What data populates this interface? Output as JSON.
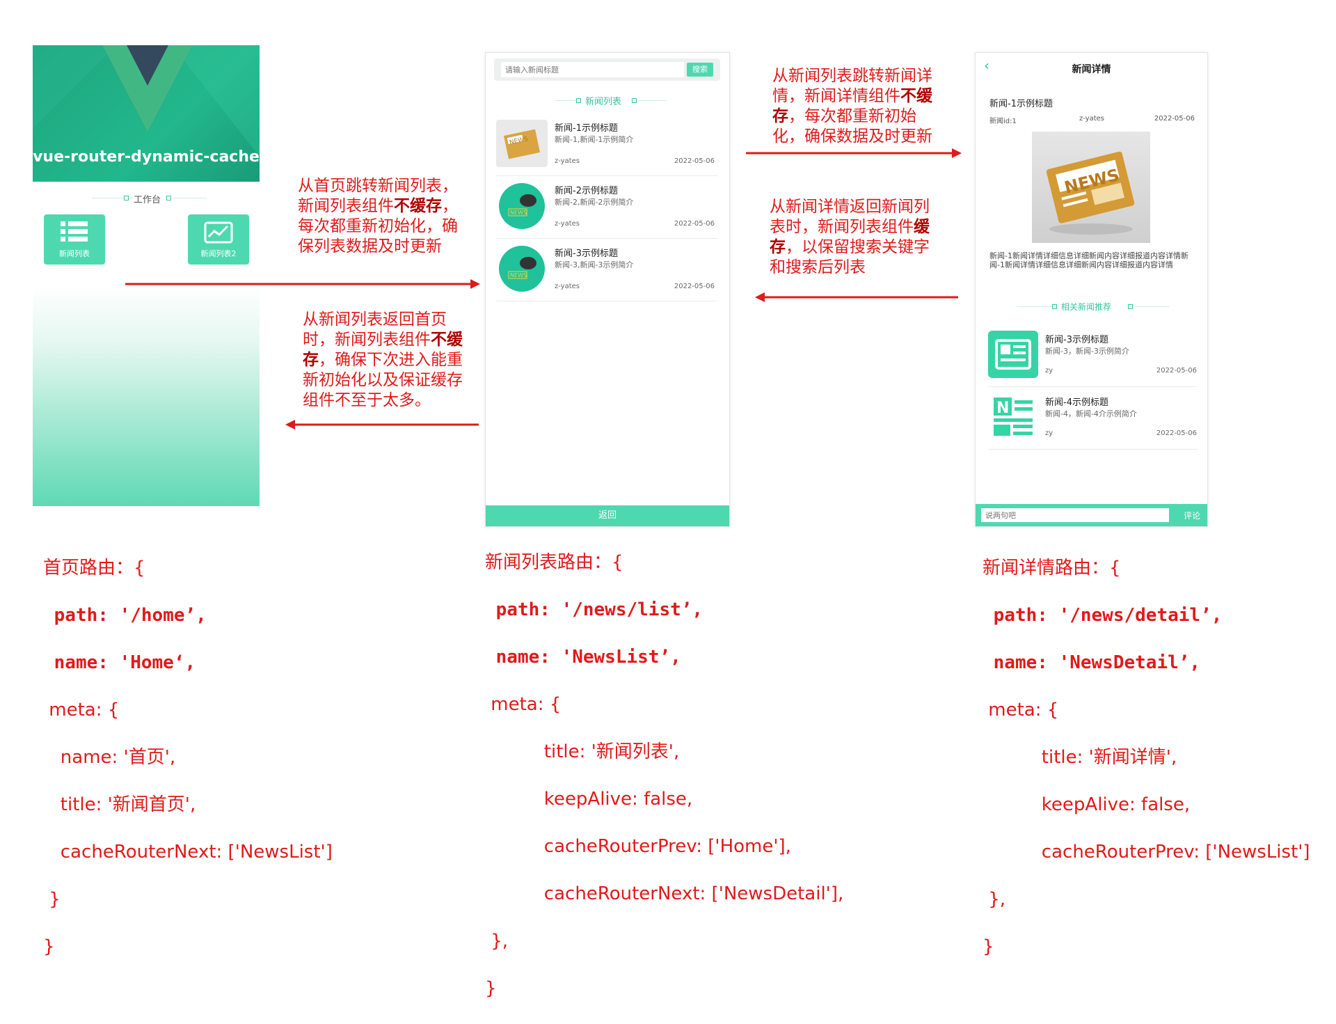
{
  "home": {
    "hero_title": "vue-router-dynamic-cache",
    "section_label": "工作台",
    "tiles": [
      {
        "label": "新闻列表",
        "icon": "list-icon"
      },
      {
        "label": "新闻列表2",
        "icon": "chart-icon"
      }
    ],
    "colors": {
      "accent": "#4ed8b0",
      "hero": "#1fa67f"
    }
  },
  "news_list": {
    "search_placeholder": "请输入新闻标题",
    "search_button": "搜索",
    "section_label": "新闻列表",
    "items": [
      {
        "title": "新闻-1示例标题",
        "desc": "新闻-1,新闻-1示例简介",
        "author": "z-yates",
        "date": "2022-05-06",
        "thumb": "newspaper-icon"
      },
      {
        "title": "新闻-2示例标题",
        "desc": "新闻-2,新闻-2示例简介",
        "author": "z-yates",
        "date": "2022-05-06",
        "thumb": "news-mic-icon"
      },
      {
        "title": "新闻-3示例标题",
        "desc": "新闻-3,新闻-3示例简介",
        "author": "z-yates",
        "date": "2022-05-06",
        "thumb": "news-mic-icon"
      }
    ],
    "back_button": "返回"
  },
  "news_detail": {
    "header_title": "新闻详情",
    "article_title": "新闻-1示例标题",
    "news_id": "新闻id:1",
    "author": "z-yates",
    "date": "2022-05-06",
    "image_label": "NEWS",
    "body": "新闻-1新闻详情详细信息详细新闻内容详细报道内容详情新闻-1新闻详情详细信息详细新闻内容详细报道内容详情",
    "related_label": "相关新闻推荐",
    "related": [
      {
        "title": "新闻-3示例标题",
        "desc": "新闻-3，新闻-3示例简介",
        "author": "zy",
        "date": "2022-05-06",
        "thumb": "article-icon"
      },
      {
        "title": "新闻-4示例标题",
        "desc": "新闻-4，新闻-4介示例简介",
        "author": "zy",
        "date": "2022-05-06",
        "thumb": "newsletter-icon"
      }
    ],
    "comment_placeholder": "说两句吧",
    "comment_button": "评论"
  },
  "notes": {
    "home_to_list": {
      "pre": "从首页跳转新闻列表，新闻列表组件",
      "bold": "不缓存",
      "post": "，每次都重新初始化，确保列表数据及时更新"
    },
    "list_to_home": {
      "pre": "从新闻列表返回首页时，新闻列表组件",
      "bold": "不缓存",
      "post": "，确保下次进入能重新初始化以及保证缓存组件不至于太多。"
    },
    "list_to_detail": {
      "pre": "从新闻列表跳转新闻详情，新闻详情组件",
      "bold": "不缓存",
      "post": "，每次都重新初始化，确保数据及时更新"
    },
    "detail_to_list": {
      "pre": "从新闻详情返回新闻列表时，新闻列表组件",
      "bold": "缓存",
      "post": "，以保留搜索关键字和搜索后列表"
    }
  },
  "routes": {
    "home": {
      "l1": "首页路由：{",
      "l2": " path: '/home’,",
      "l3": " name: 'Home‘,",
      "l4": " meta: {",
      "l5": "   name: '首页',",
      "l6": "   title: '新闻首页',",
      "l7": "   cacheRouterNext: ['NewsList']",
      "l8": " }",
      "l9": "}"
    },
    "list": {
      "l1": "新闻列表路由：{",
      "l2": " path: '/news/list’,",
      "l3": " name: 'NewsList’,",
      "l4": " meta: {",
      "l5": "   title: '新闻列表',",
      "l6": "   keepAlive: false,",
      "l7": "   cacheRouterPrev: ['Home'],",
      "l8": "   cacheRouterNext: ['NewsDetail'],",
      "l9": " },",
      "l10": "}"
    },
    "detail": {
      "l1": "新闻详情路由：{",
      "l2": " path: '/news/detail’,",
      "l3": " name: 'NewsDetail’,",
      "l4": " meta: {",
      "l5": "   title: '新闻详情',",
      "l6": "   keepAlive: false,",
      "l7": "   cacheRouterPrev: ['NewsList']",
      "l8": " },",
      "l9": "}"
    }
  },
  "colors": {
    "annotation": "#e11a1a",
    "accent": "#4ed8b0"
  }
}
